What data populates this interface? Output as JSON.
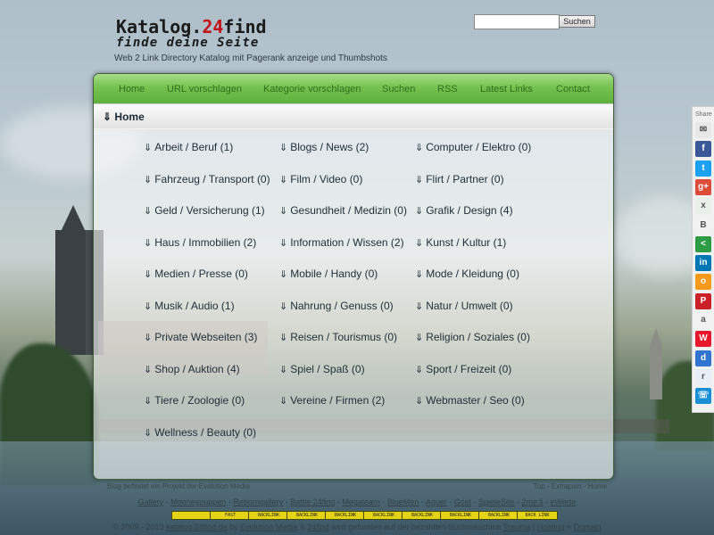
{
  "header": {
    "logo_line1": "Katalog.",
    "logo_line1_red": "24",
    "logo_line1_rest": "find",
    "logo_line2": "finde deine Seite",
    "tagline": "Web 2 Link Directory Katalog mit Pagerank anzeige und Thumbshots"
  },
  "search": {
    "value": "",
    "button_label": "Suchen"
  },
  "nav": {
    "items": [
      {
        "label": "Home"
      },
      {
        "label": "URL vorschlagen"
      },
      {
        "label": "Kategorie vorschlagen"
      },
      {
        "label": "Suchen"
      },
      {
        "label": "RSS"
      },
      {
        "label": "Latest Links"
      },
      {
        "label": "Contact"
      }
    ]
  },
  "breadcrumb": {
    "arrow": "⇓",
    "label": "Home"
  },
  "categories": [
    {
      "label": "Arbeit / Beruf (1)"
    },
    {
      "label": "Blogs / News (2)"
    },
    {
      "label": "Computer / Elektro (0)"
    },
    {
      "label": "Fahrzeug / Transport (0)"
    },
    {
      "label": "Film / Video (0)"
    },
    {
      "label": "Flirt / Partner (0)"
    },
    {
      "label": "Geld / Versicherung (1)"
    },
    {
      "label": "Gesundheit / Medizin (0)"
    },
    {
      "label": "Grafik / Design (4)"
    },
    {
      "label": "Haus / Immobilien (2)"
    },
    {
      "label": "Information / Wissen (2)"
    },
    {
      "label": "Kunst / Kultur (1)"
    },
    {
      "label": "Medien / Presse (0)"
    },
    {
      "label": "Mobile / Handy (0)"
    },
    {
      "label": "Mode / Kleidung (0)"
    },
    {
      "label": "Musik / Audio (1)"
    },
    {
      "label": "Nahrung / Genuss (0)"
    },
    {
      "label": "Natur / Umwelt (0)"
    },
    {
      "label": "Private Webseiten (3)"
    },
    {
      "label": "Reisen / Tourismus (0)"
    },
    {
      "label": "Religion / Soziales (0)"
    },
    {
      "label": "Shop / Auktion (4)"
    },
    {
      "label": "Spiel / Spaß (0)"
    },
    {
      "label": "Sport / Freizeit (0)"
    },
    {
      "label": "Tiere / Zoologie (0)"
    },
    {
      "label": "Vereine / Firmen (2)"
    },
    {
      "label": "Webmaster / Seo (0)"
    },
    {
      "label": "Wellness / Beauty (0)"
    }
  ],
  "category_arrow": "⇓",
  "share": {
    "label": "Share",
    "icons": [
      {
        "name": "email-icon",
        "glyph": "✉",
        "color": "#e8e8e8"
      },
      {
        "name": "facebook-icon",
        "glyph": "f",
        "color": "#3b5998"
      },
      {
        "name": "twitter-icon",
        "glyph": "t",
        "color": "#1da1f2"
      },
      {
        "name": "googleplus-icon",
        "glyph": "g+",
        "color": "#dd4b39"
      },
      {
        "name": "xing-icon",
        "glyph": "x",
        "color": "#e9efe9"
      },
      {
        "name": "vk-icon",
        "glyph": "B",
        "color": "#f2f2f2"
      },
      {
        "name": "share-icon",
        "glyph": "<",
        "color": "#2e9b45"
      },
      {
        "name": "linkedin-icon",
        "glyph": "in",
        "color": "#0077b5"
      },
      {
        "name": "odnoklassniki-icon",
        "glyph": "o",
        "color": "#f59a1a"
      },
      {
        "name": "pinterest-icon",
        "glyph": "P",
        "color": "#cb2027"
      },
      {
        "name": "amazon-icon",
        "glyph": "a",
        "color": "#f2f2f2"
      },
      {
        "name": "weibo-icon",
        "glyph": "W",
        "color": "#e6162d"
      },
      {
        "name": "delicious-icon",
        "glyph": "d",
        "color": "#3274d1"
      },
      {
        "name": "reddit-icon",
        "glyph": "r",
        "color": "#e8eef5"
      },
      {
        "name": "phone-icon",
        "glyph": "☏",
        "color": "#1b8fd6"
      }
    ]
  },
  "footer": {
    "line1_left": "Blog befindet ein Projekt der Evolution Media",
    "line1_right": "Top - Extrapain - Home",
    "links": [
      "Gallery",
      "Mooneypuppen",
      "Reborngallery",
      "Battle 24find",
      "Megalearn",
      "BlueMen",
      "Aquer",
      "Gost",
      "SpieleSite",
      "2me.li",
      "eWerte"
    ],
    "badges": [
      "",
      "FAST",
      "BACKLINK",
      "BACKLINK",
      "BACKLINK",
      "BACKLINK",
      "BACKLINK",
      "BACKLINK",
      "BACKLINK",
      "BACK LINK"
    ],
    "copyright_pre": "© 2009 - 2013",
    "site_link": "katalog.24find.de",
    "by": "by",
    "evolution": "Evolution Media",
    "amp": "&",
    "find": "24find",
    "found_text": "wird gefunden auf der bezahlten Suchmaschine",
    "trauma": "Trauma",
    "hosting": "Hosting",
    "plus": "+",
    "domain": "Domain"
  }
}
